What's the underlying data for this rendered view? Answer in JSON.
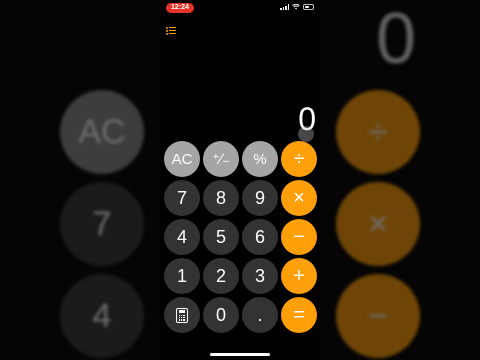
{
  "status_bar": {
    "time": "12:24"
  },
  "display": {
    "value": "0"
  },
  "keys": {
    "ac": "AC",
    "plus_minus": "⁺∕₋",
    "percent": "%",
    "divide": "÷",
    "seven": "7",
    "eight": "8",
    "nine": "9",
    "multiply": "×",
    "four": "4",
    "five": "5",
    "six": "6",
    "minus": "−",
    "one": "1",
    "two": "2",
    "three": "3",
    "plus": "+",
    "zero": "0",
    "decimal": ".",
    "equals": "="
  },
  "icons": {
    "history": "list-icon",
    "calculator": "calculator-icon"
  },
  "colors": {
    "operator": "#ff9f0a",
    "function": "#a5a5a5",
    "digit": "#333333",
    "recording": "#e5332a"
  }
}
